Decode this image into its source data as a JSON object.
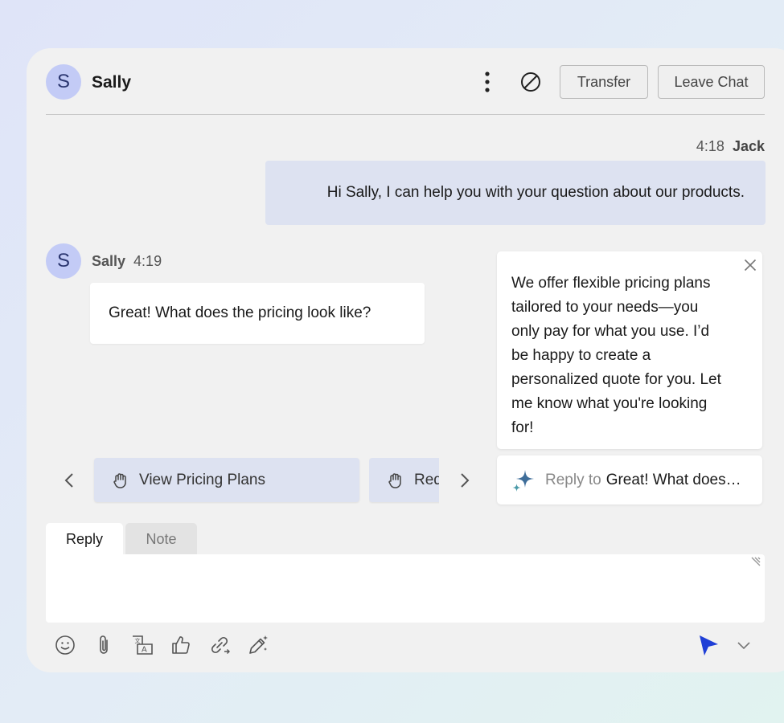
{
  "header": {
    "avatar_initial": "S",
    "name": "Sally",
    "transfer_label": "Transfer",
    "leave_label": "Leave Chat"
  },
  "messages": [
    {
      "time": "4:18",
      "sender": "Jack",
      "text": "Hi Sally, I can help you with your question about our products."
    },
    {
      "avatar_initial": "S",
      "sender": "Sally",
      "time": "4:19",
      "text": "Great! What does the pricing look like?"
    }
  ],
  "suggestion": {
    "text": "We offer flexible pricing plans\ntailored to your needs—you\nonly pay for what you use. I’d\nbe happy to create a\npersonalized quote for you. Let\nme know what you're looking\nfor!",
    "reply_prefix": "Reply to",
    "reply_target": "Great! What does…"
  },
  "quick_actions": [
    {
      "label": "View Pricing Plans",
      "icon": "hand-icon"
    },
    {
      "label": "Req",
      "icon": "hand-icon"
    }
  ],
  "composer": {
    "tabs": [
      "Reply",
      "Note"
    ],
    "active_tab": "Reply",
    "toolbar_icons": [
      "emoji-icon",
      "attachment-icon",
      "translate-icon",
      "thumbs-up-icon",
      "link-icon",
      "ai-pen-icon"
    ],
    "send_icon": "send-icon"
  },
  "colors": {
    "accent": "#1f3fd6",
    "avatar_bg": "#c3cbf6",
    "bubble_out": "#dde2f1",
    "panel_bg": "#f1f1f1"
  }
}
